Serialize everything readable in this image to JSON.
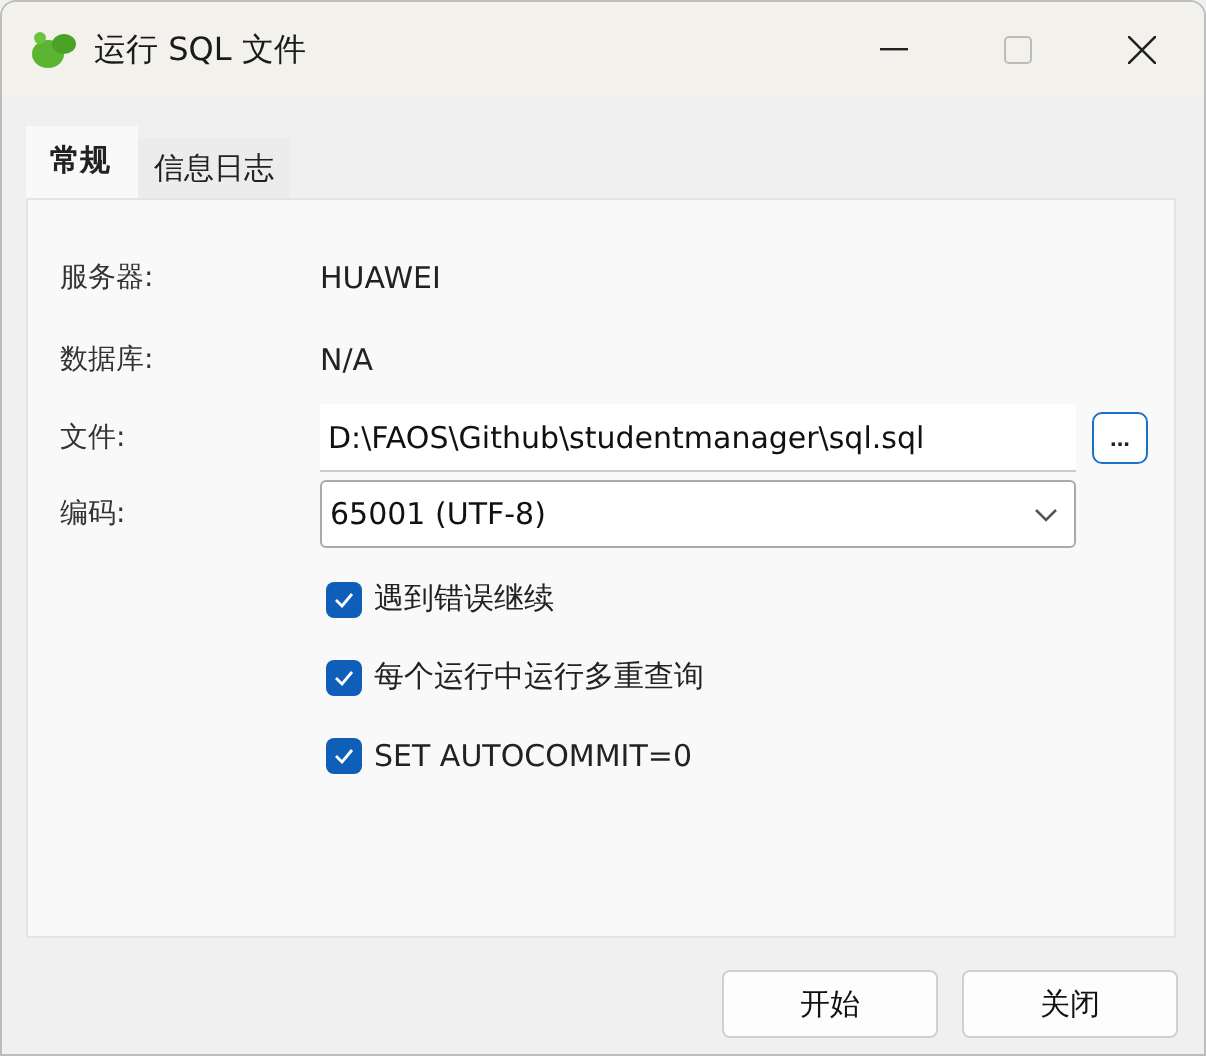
{
  "window": {
    "title": "运行 SQL 文件"
  },
  "tabs": [
    {
      "label": "常规",
      "selected": true
    },
    {
      "label": "信息日志",
      "selected": false
    }
  ],
  "fields": [
    {
      "kind": "text",
      "label": "服务器:",
      "value": "HUAWEI"
    },
    {
      "kind": "text",
      "label": "数据库:",
      "value": "N/A"
    },
    {
      "kind": "file",
      "label": "文件:",
      "value": "D:\\FAOS\\Github\\studentmanager\\sql.sql",
      "browse": "..."
    },
    {
      "kind": "select",
      "label": "编码:",
      "value": "65001 (UTF-8)"
    }
  ],
  "options": [
    {
      "label": "遇到错误继续",
      "checked": true
    },
    {
      "label": "每个运行中运行多重查询",
      "checked": true
    },
    {
      "label": "SET AUTOCOMMIT=0",
      "checked": true
    }
  ],
  "buttons": [
    "开始",
    "关闭"
  ]
}
